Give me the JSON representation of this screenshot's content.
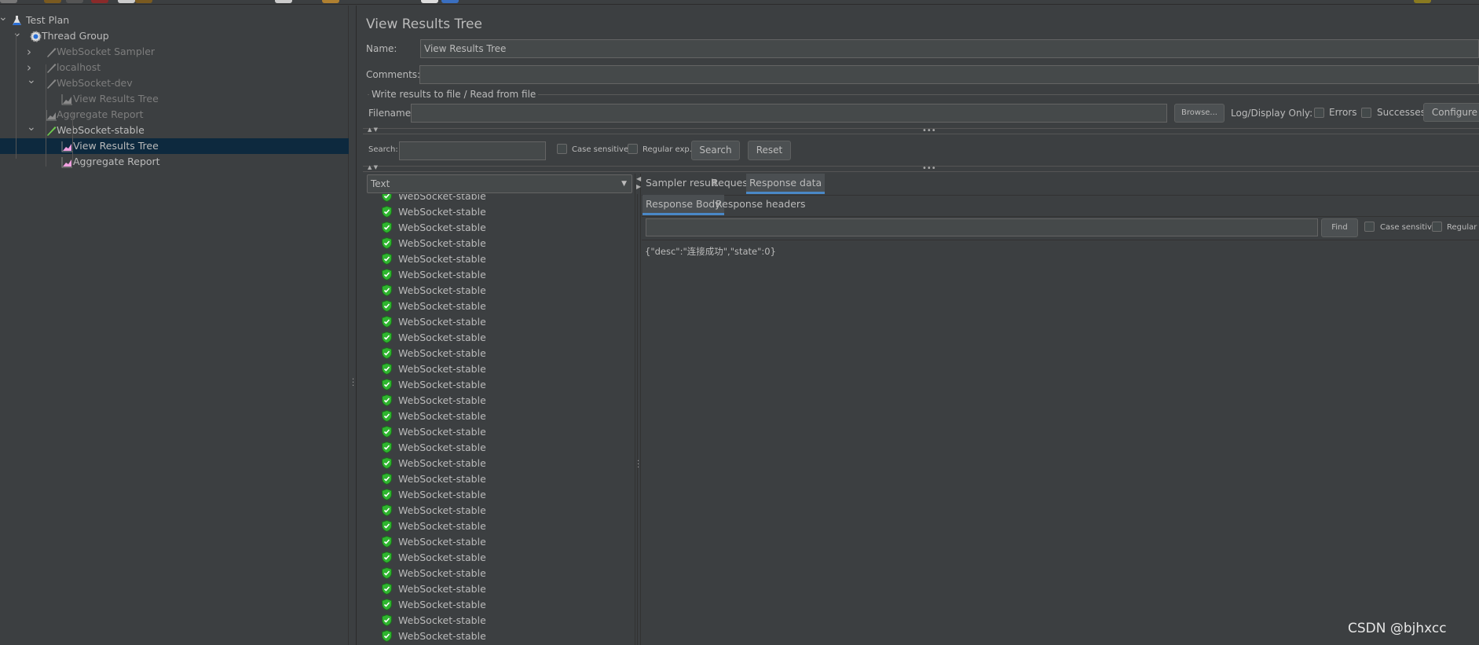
{
  "tree": {
    "items": [
      {
        "label": "Test Plan",
        "icon": "flask-icon",
        "level": 0,
        "expanded": true,
        "disabled": false,
        "selected": false
      },
      {
        "label": "Thread Group",
        "icon": "gear-icon",
        "level": 1,
        "expanded": true,
        "disabled": false,
        "selected": false
      },
      {
        "label": "WebSocket Sampler",
        "icon": "pipette-icon",
        "level": 2,
        "expanded": false,
        "disabled": true,
        "selected": false
      },
      {
        "label": "localhost",
        "icon": "pipette-icon",
        "level": 2,
        "expanded": false,
        "disabled": true,
        "selected": false
      },
      {
        "label": "WebSocket-dev",
        "icon": "pipette-icon",
        "level": 2,
        "expanded": true,
        "disabled": true,
        "selected": false
      },
      {
        "label": "View Results Tree",
        "icon": "listener-icon",
        "level": 3,
        "expanded": null,
        "disabled": true,
        "selected": false
      },
      {
        "label": "Aggregate Report",
        "icon": "listener-icon",
        "level": 2,
        "expanded": null,
        "disabled": true,
        "selected": false
      },
      {
        "label": "WebSocket-stable",
        "icon": "pipette-icon",
        "level": 2,
        "expanded": true,
        "disabled": false,
        "selected": false
      },
      {
        "label": "View Results Tree",
        "icon": "listener-icon",
        "level": 3,
        "expanded": null,
        "disabled": false,
        "selected": true
      },
      {
        "label": "Aggregate Report",
        "icon": "listener-icon",
        "level": 3,
        "expanded": null,
        "disabled": false,
        "selected": false
      }
    ]
  },
  "panel": {
    "title": "View Results Tree",
    "name_label": "Name:",
    "name_value": "View Results Tree",
    "comments_label": "Comments:",
    "comments_value": "",
    "file_group_title": "Write results to file / Read from file",
    "filename_label": "Filename",
    "filename_value": "",
    "browse_label": "Browse...",
    "log_display_label": "Log/Display Only:",
    "errors_label": "Errors",
    "successes_label": "Successes",
    "configure_label": "Configure"
  },
  "search": {
    "label": "Search:",
    "value": "",
    "case_sensitive_label": "Case sensitive",
    "regexp_label": "Regular exp.",
    "search_button": "Search",
    "reset_button": "Reset"
  },
  "renderer": {
    "selected": "Text"
  },
  "results": {
    "status_icon": "success-shield-icon",
    "items": [
      "WebSocket-stable",
      "WebSocket-stable",
      "WebSocket-stable",
      "WebSocket-stable",
      "WebSocket-stable",
      "WebSocket-stable",
      "WebSocket-stable",
      "WebSocket-stable",
      "WebSocket-stable",
      "WebSocket-stable",
      "WebSocket-stable",
      "WebSocket-stable",
      "WebSocket-stable",
      "WebSocket-stable",
      "WebSocket-stable",
      "WebSocket-stable",
      "WebSocket-stable",
      "WebSocket-stable",
      "WebSocket-stable",
      "WebSocket-stable",
      "WebSocket-stable",
      "WebSocket-stable",
      "WebSocket-stable",
      "WebSocket-stable",
      "WebSocket-stable",
      "WebSocket-stable",
      "WebSocket-stable",
      "WebSocket-stable",
      "WebSocket-stable"
    ]
  },
  "detail": {
    "tabs": [
      "Sampler result",
      "Request",
      "Response data"
    ],
    "active_tab": "Response data",
    "subtabs": [
      "Response Body",
      "Response headers"
    ],
    "active_subtab": "Response Body",
    "find_value": "",
    "find_button": "Find",
    "case_sensitive_label": "Case sensitive",
    "regexp_label": "Regular exp.",
    "response_body": "{\"desc\":\"连接成功\",\"state\":0}"
  },
  "watermark": "CSDN @bjhxcc",
  "colors": {
    "background": "#3c3f41",
    "selection": "#0d293e",
    "accent": "#4a88c7",
    "success": "#2fb52f"
  }
}
